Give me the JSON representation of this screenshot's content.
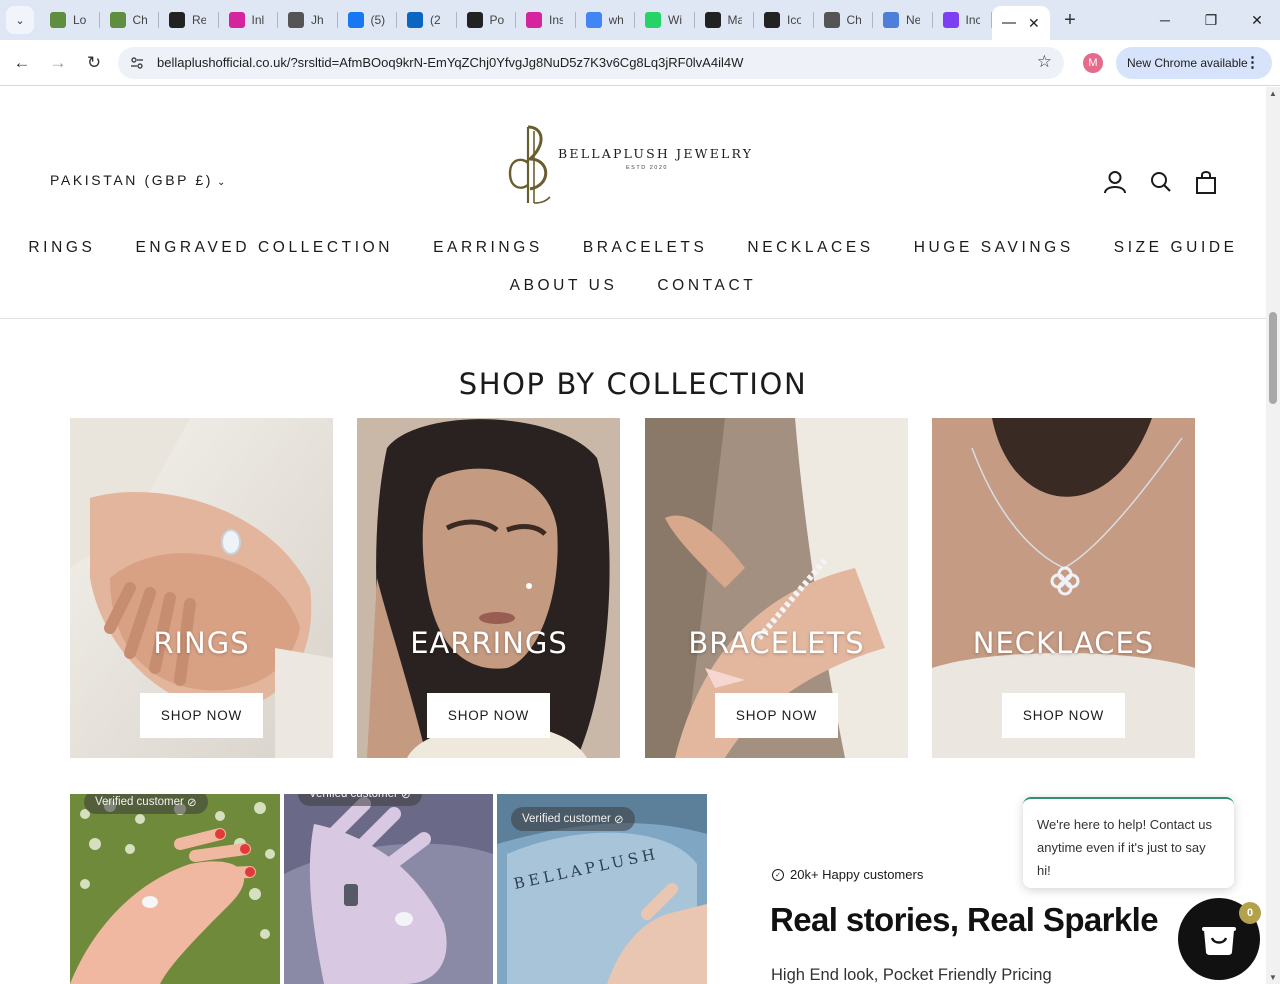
{
  "browser": {
    "tabs": [
      {
        "title": "Lo",
        "icon": "shopify-icon",
        "color": "#5e8e3e"
      },
      {
        "title": "Ch",
        "icon": "shopify-icon",
        "color": "#5e8e3e"
      },
      {
        "title": "Re",
        "icon": "slashed-circle-icon",
        "color": "#222222"
      },
      {
        "title": "Inl",
        "icon": "instagram-icon",
        "color": "#d6249f"
      },
      {
        "title": "Jh",
        "icon": "ns-icon",
        "color": "#555555"
      },
      {
        "title": "(5)",
        "icon": "facebook-icon",
        "color": "#1877f2"
      },
      {
        "title": "(2",
        "icon": "linkedin-icon",
        "color": "#0a66c2"
      },
      {
        "title": "Po",
        "icon": "openai-icon",
        "color": "#222222"
      },
      {
        "title": "Ins",
        "icon": "instagram-icon",
        "color": "#d6249f"
      },
      {
        "title": "wh",
        "icon": "google-icon",
        "color": "#4285f4"
      },
      {
        "title": "Wi",
        "icon": "whatsapp-icon",
        "color": "#25d366"
      },
      {
        "title": "Ma",
        "icon": "slashed-circle-icon",
        "color": "#222222"
      },
      {
        "title": "Ico",
        "icon": "openai-icon",
        "color": "#222222"
      },
      {
        "title": "Ch",
        "icon": "ns-icon",
        "color": "#555555"
      },
      {
        "title": "Ne",
        "icon": "chrome-icon",
        "color": "#4d7ed9"
      },
      {
        "title": "Inc",
        "icon": "bold-b-icon",
        "color": "#7e3ff2"
      }
    ],
    "active_tab_close": "✕",
    "new_tab": "+",
    "url": "bellaplushofficial.co.uk/?srsltid=AfmBOoq9krN-EmYqZChj0YfvgJg8NuD5z7K3v6Cg8Lq3jRF0lvA4il4W",
    "profile_initial": "M",
    "update_label": "New Chrome available"
  },
  "header": {
    "country": "PAKISTAN (GBP £)",
    "logo_name": "BELLAPLUSH JEWELRY",
    "logo_sub": "ESTD 2020",
    "logo_color": "#6b5e2e"
  },
  "nav": {
    "row1": [
      "RINGS",
      "ENGRAVED COLLECTION",
      "EARRINGS",
      "BRACELETS",
      "NECKLACES",
      "HUGE SAVINGS",
      "SIZE GUIDE"
    ],
    "row2": [
      "ABOUT US",
      "CONTACT"
    ]
  },
  "collection": {
    "title": "SHOP BY COLLECTION",
    "cards": [
      {
        "label": "RINGS",
        "button": "SHOP NOW"
      },
      {
        "label": "EARRINGS",
        "button": "SHOP NOW"
      },
      {
        "label": "BRACELETS",
        "button": "SHOP NOW"
      },
      {
        "label": "NECKLACES",
        "button": "SHOP NOW"
      }
    ]
  },
  "reviews": {
    "verified_label": "Verified customer",
    "photo_brand_text": "BELLAPLUSH",
    "happy": "20k+ Happy customers",
    "heading": "Real stories, Real Sparkle",
    "tagline": "High End look, Pocket Friendly Pricing"
  },
  "chat": {
    "message": "We're here to help! Contact us anytime even if it's just to say hi!",
    "badge_count": "0"
  }
}
